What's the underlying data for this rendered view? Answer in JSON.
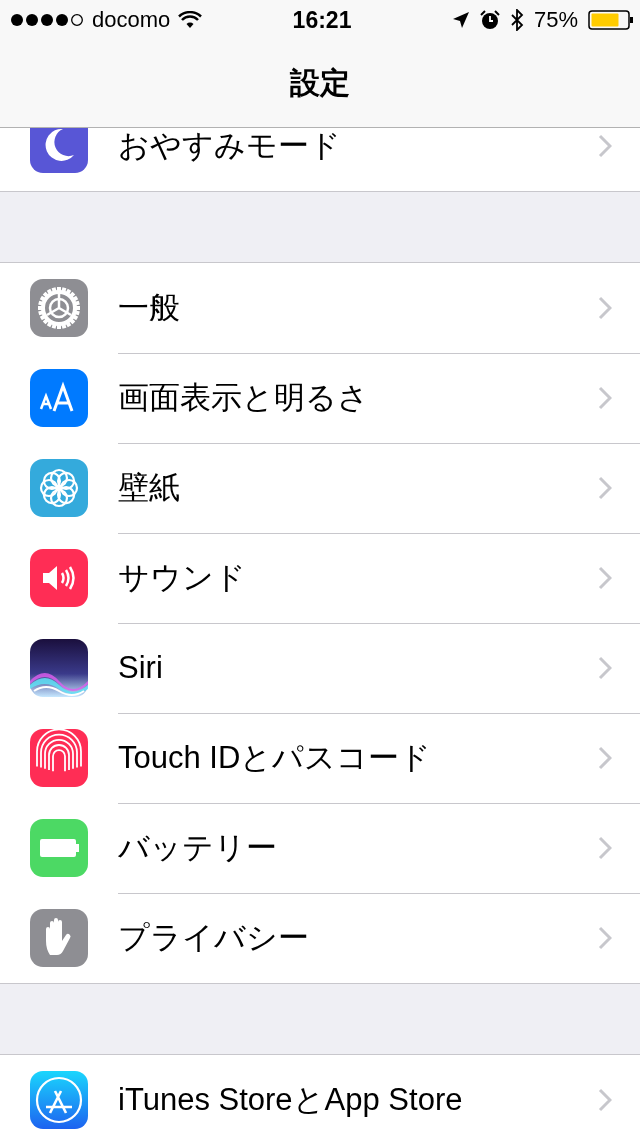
{
  "status_bar": {
    "carrier": "docomo",
    "time": "16:21",
    "battery": "75%"
  },
  "nav_bar": {
    "title": "設定"
  },
  "groups": [
    {
      "items": [
        {
          "label": "おやすみモード"
        }
      ]
    },
    {
      "items": [
        {
          "label": "一般"
        },
        {
          "label": "画面表示と明るさ"
        },
        {
          "label": "壁紙"
        },
        {
          "label": "サウンド"
        },
        {
          "label": "Siri"
        },
        {
          "label": "Touch IDとパスコード"
        },
        {
          "label": "バッテリー"
        },
        {
          "label": "プライバシー"
        }
      ]
    },
    {
      "items": [
        {
          "label": "iTunes StoreとApp Store"
        }
      ]
    }
  ]
}
